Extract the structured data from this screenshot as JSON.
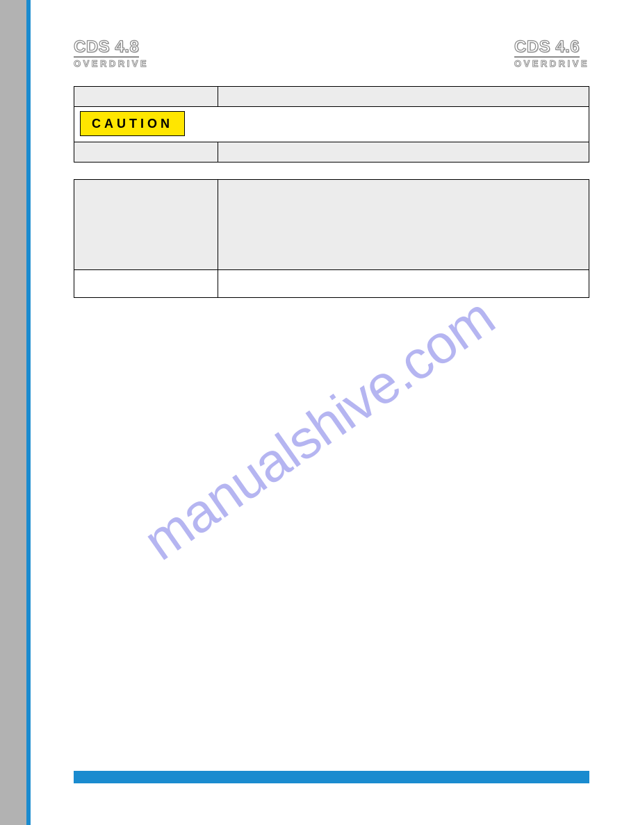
{
  "logos": {
    "left": {
      "top": "CDS 4.8",
      "bottom": "OVERDRIVE"
    },
    "right": {
      "top": "CDS 4.6",
      "bottom": "OVERDRIVE"
    }
  },
  "table1": {
    "row1": {
      "label": "",
      "value": ""
    },
    "caution": {
      "badge": "CAUTION",
      "text": ""
    },
    "row3": {
      "label": "",
      "value": ""
    }
  },
  "table2": {
    "row1": {
      "label": "",
      "value": ""
    },
    "row2": {
      "label": "",
      "value": ""
    }
  },
  "watermark": "manualshive.com"
}
